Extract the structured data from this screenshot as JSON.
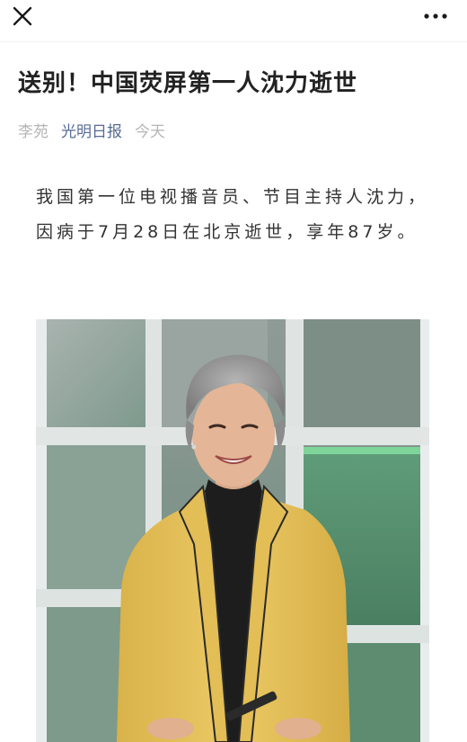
{
  "toolbar": {
    "close_icon": "close-icon",
    "more_icon": "more-dots-icon"
  },
  "article": {
    "title": "送别！中国荧屏第一人沈力逝世",
    "author": "李苑",
    "account": "光明日报",
    "date": "今天",
    "body": "我国第一位电视播音员、节目主持人沈力，因病于7月28日在北京逝世，享年87岁。"
  },
  "photo": {
    "subject": "portrait-photo"
  },
  "colors": {
    "link": "#576b95",
    "meta_gray": "#b5b5b5",
    "jacket_yellow": "#e7c25a",
    "background_green": "#6f9a83"
  }
}
